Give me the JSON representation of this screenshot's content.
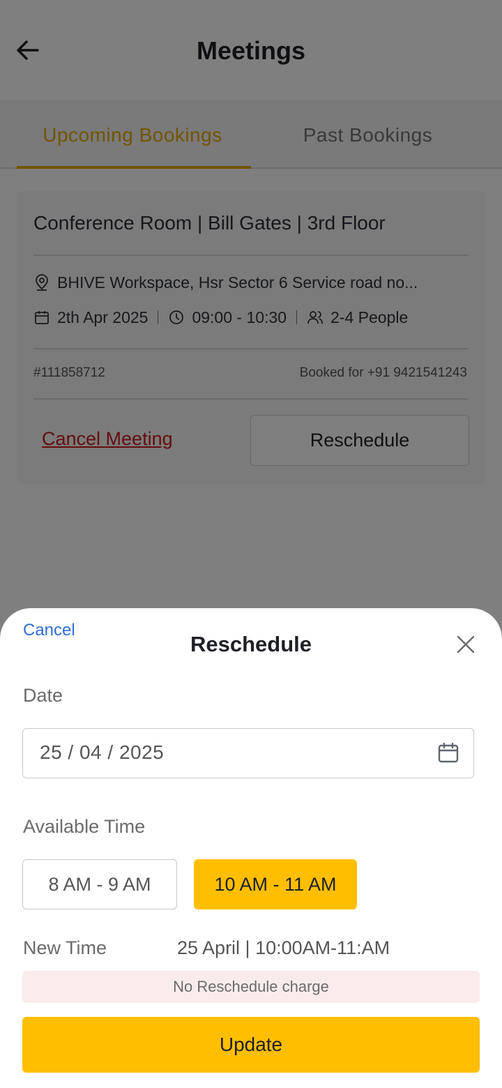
{
  "header": {
    "title": "Meetings"
  },
  "tabs": [
    {
      "label": "Upcoming Bookings",
      "active": true
    },
    {
      "label": "Past Bookings",
      "active": false
    }
  ],
  "booking": {
    "room": "Conference Room | Bill Gates | 3rd Floor",
    "address": "BHIVE Workspace, Hsr Sector 6 Service road no...",
    "date": "2th Apr 2025",
    "time": "09:00 - 10:30",
    "people": "2-4 People",
    "booking_id": "#111858712",
    "booked_for": "Booked for +91 9421541243",
    "cancel_label": "Cancel Meeting",
    "reschedule_label": "Reschedule"
  },
  "sheet": {
    "cancel_label": "Cancel",
    "title": "Reschedule",
    "date_label": "Date",
    "date_value": "25 / 04 / 2025",
    "available_time_label": "Available Time",
    "slots": [
      {
        "label": "8 AM - 9 AM",
        "selected": false
      },
      {
        "label": "10 AM - 11 AM",
        "selected": true
      }
    ],
    "new_time_label": "New Time",
    "new_time_value": "25 April | 10:00AM-11:AM",
    "charge_note": "No Reschedule charge",
    "update_label": "Update"
  },
  "colors": {
    "accent": "#ffbe00",
    "tab_active": "#e7a800",
    "cancel_red": "#c81a1a",
    "link_blue": "#2f6fd6"
  },
  "icons": [
    "back-arrow-icon",
    "location-pin-icon",
    "calendar-icon",
    "clock-icon",
    "people-icon",
    "close-icon"
  ]
}
